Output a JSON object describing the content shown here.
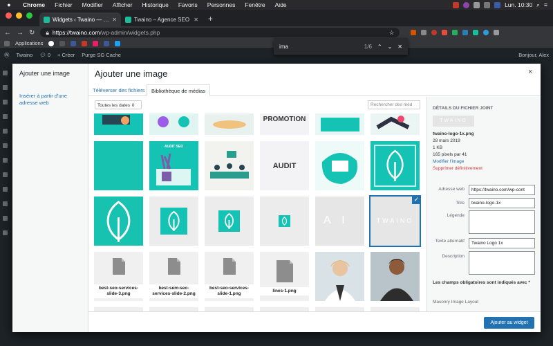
{
  "menubar": {
    "items": [
      "Chrome",
      "Fichier",
      "Modifier",
      "Afficher",
      "Historique",
      "Favoris",
      "Personnes",
      "Fenêtre",
      "Aide"
    ],
    "clock": "Lun. 10:30"
  },
  "tabs": [
    {
      "label": "Widgets ‹ Twaino — WordPress",
      "active": true
    },
    {
      "label": "Twaino – Agence SEO",
      "active": false
    }
  ],
  "address": {
    "host": "https://twaino.com",
    "path": "/wp-admin/widgets.php"
  },
  "bookmarks": {
    "label": "Applications"
  },
  "find": {
    "query": "ima",
    "count": "1/6"
  },
  "wpbar": {
    "site": "Twaino",
    "comments": "0",
    "new": "+ Créer",
    "purge": "Purge SG Cache",
    "greeting": "Bonjour, Alex"
  },
  "modal": {
    "menu_title": "Ajouter une image",
    "menu_link": "Insérer à partir d'une adresse web",
    "title": "Ajouter une image",
    "close": "×",
    "tab_upload": "Téléverser des fichiers",
    "tab_library": "Bibliothèque de médias",
    "filter": "Toutes les dates ⇕",
    "search_placeholder": "Rechercher des méd",
    "insert_button": "Ajouter au widget"
  },
  "grid": [
    {
      "caption": ""
    },
    {
      "caption": ""
    },
    {
      "caption": ""
    },
    {
      "caption": "PROMOTION"
    },
    {
      "caption": ""
    },
    {
      "caption": ""
    },
    {
      "caption": ""
    },
    {
      "caption": "AUDIT SEO"
    },
    {
      "caption": ""
    },
    {
      "caption": "AUDIT"
    },
    {
      "caption": ""
    },
    {
      "caption": ""
    },
    {
      "caption": ""
    },
    {
      "caption": ""
    },
    {
      "caption": ""
    },
    {
      "caption": ""
    },
    {
      "caption": "A I"
    },
    {
      "caption": "TWAINO"
    },
    {
      "caption": "best-seo-services-slide-3.png"
    },
    {
      "caption": "best-sem-seo-services-slide-2.png"
    },
    {
      "caption": "best-seo-services-slide-1.png"
    },
    {
      "caption": "lines-1.png"
    },
    {
      "caption": ""
    },
    {
      "caption": ""
    }
  ],
  "details": {
    "heading": "DÉTAILS DU FICHIER JOINT",
    "filename": "twaino-logo-1x.png",
    "date": "28 mars 2019",
    "size": "1 KB",
    "dimensions": "165 pixels par 41",
    "edit": "Modifier l'image",
    "delete": "Supprimer définitivement",
    "url_label": "Adresse web",
    "url_value": "https://twaino.com/wp-cont",
    "title_label": "Titre",
    "title_value": "twaino-logo-1x",
    "legend_label": "Légende",
    "alt_label": "Texte alternatif",
    "alt_value": "Twaino Logo 1x",
    "desc_label": "Description",
    "required": "Les champs obligatoires sont indiqués avec *",
    "masonry": "Masonry Image Layout"
  }
}
